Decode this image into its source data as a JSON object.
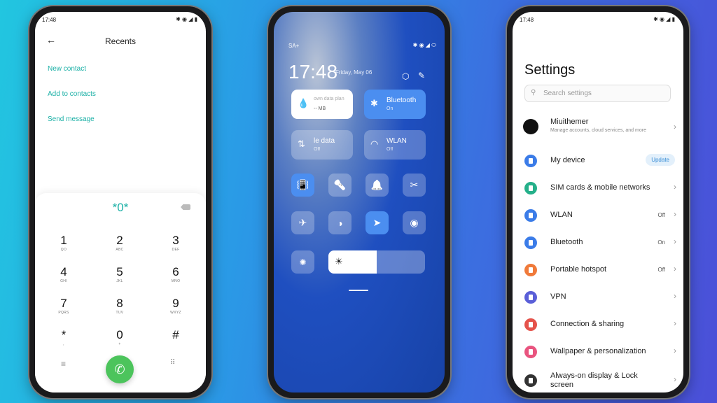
{
  "dialer": {
    "status_time": "17:48",
    "title": "Recents",
    "links": [
      "New contact",
      "Add to contacts",
      "Send message"
    ],
    "entry": "*0*",
    "keys": [
      {
        "d": "1",
        "l": "QO"
      },
      {
        "d": "2",
        "l": "ABC"
      },
      {
        "d": "3",
        "l": "DEF"
      },
      {
        "d": "4",
        "l": "GHI"
      },
      {
        "d": "5",
        "l": "JKL"
      },
      {
        "d": "6",
        "l": "MNO"
      },
      {
        "d": "7",
        "l": "PQRS"
      },
      {
        "d": "8",
        "l": "TUV"
      },
      {
        "d": "9",
        "l": "WXYZ"
      },
      {
        "d": "*",
        "l": ","
      },
      {
        "d": "0",
        "l": "+"
      },
      {
        "d": "#",
        "l": ""
      }
    ],
    "call_color": "#4cc45c",
    "accent": "#1bb0a6"
  },
  "control": {
    "carrier": "SA+",
    "time": "17:48",
    "date": "Friday, May 06",
    "tiles": [
      {
        "title": "own data plan",
        "sub": "-- MB",
        "icon": "water-drop-icon"
      },
      {
        "title": "Bluetooth",
        "sub": "On",
        "icon": "bluetooth-icon"
      },
      {
        "title": "le data",
        "sub": "Off",
        "icon": "mobile-data-icon"
      },
      {
        "title": "WLAN",
        "sub": "Off",
        "icon": "wifi-icon"
      }
    ],
    "toggles": [
      {
        "icon": "vibrate-icon",
        "on": true,
        "g": "📳"
      },
      {
        "icon": "flashlight-icon",
        "on": false,
        "g": "🔦"
      },
      {
        "icon": "bell-icon",
        "on": false,
        "g": "🔔"
      },
      {
        "icon": "screenshot-icon",
        "on": false,
        "g": "✂"
      },
      {
        "icon": "airplane-icon",
        "on": false,
        "g": "✈"
      },
      {
        "icon": "dark-mode-icon",
        "on": false,
        "g": "◑"
      },
      {
        "icon": "location-icon",
        "on": true,
        "g": "➤"
      },
      {
        "icon": "eye-icon",
        "on": false,
        "g": "◉"
      }
    ],
    "brightness": 0.5,
    "accent": "#4b8ef0"
  },
  "settings": {
    "status_time": "17:48",
    "title": "Settings",
    "search_placeholder": "Search settings",
    "account": {
      "name": "Miuithemer",
      "sub": "Manage accounts, cloud services, and more"
    },
    "items": [
      {
        "label": "My device",
        "badge": "Update",
        "color": "#3b7ce8"
      },
      {
        "label": "SIM cards & mobile networks",
        "color": "#25b08a"
      },
      {
        "label": "WLAN",
        "value": "Off",
        "color": "#3b7ce8"
      },
      {
        "label": "Bluetooth",
        "value": "On",
        "color": "#3b7ce8"
      },
      {
        "label": "Portable hotspot",
        "value": "Off",
        "color": "#f07a3a"
      },
      {
        "label": "VPN",
        "color": "#5a5fd8"
      },
      {
        "label": "Connection & sharing",
        "color": "#e5534b"
      },
      {
        "label": "Wallpaper & personalization",
        "color": "#e9547f"
      },
      {
        "label": "Always-on display & Lock screen",
        "color": "#333333"
      }
    ]
  }
}
